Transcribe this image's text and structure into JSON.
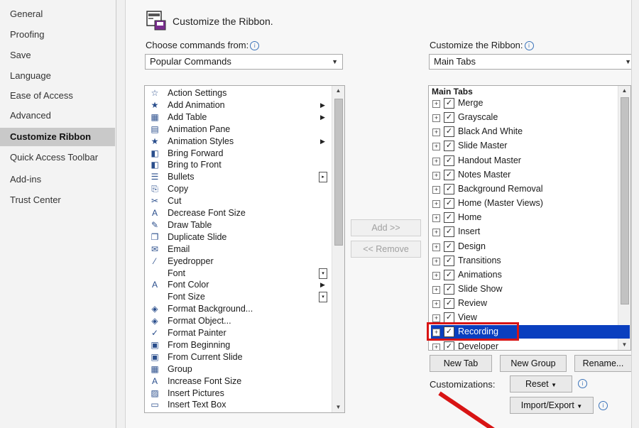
{
  "nav": {
    "items": [
      {
        "label": "General"
      },
      {
        "label": "Proofing"
      },
      {
        "label": "Save"
      },
      {
        "label": "Language"
      },
      {
        "label": "Ease of Access"
      },
      {
        "label": "Advanced"
      },
      {
        "label": "Customize Ribbon"
      },
      {
        "label": "Quick Access Toolbar"
      },
      {
        "label": "Add-ins"
      },
      {
        "label": "Trust Center"
      }
    ],
    "active_index": 6
  },
  "header": {
    "title": "Customize the Ribbon."
  },
  "left": {
    "label": "Choose commands from:",
    "combo_value": "Popular Commands",
    "commands": [
      {
        "label": "Action Settings",
        "icon": "☆"
      },
      {
        "label": "Add Animation",
        "icon": "★",
        "submenu": true
      },
      {
        "label": "Add Table",
        "icon": "▦",
        "submenu": true
      },
      {
        "label": "Animation Pane",
        "icon": "▤"
      },
      {
        "label": "Animation Styles",
        "icon": "★",
        "submenu": true
      },
      {
        "label": "Bring Forward",
        "icon": "◧"
      },
      {
        "label": "Bring to Front",
        "icon": "◧"
      },
      {
        "label": "Bullets",
        "icon": "☰",
        "box": "▸"
      },
      {
        "label": "Copy",
        "icon": "⎘"
      },
      {
        "label": "Cut",
        "icon": "✂"
      },
      {
        "label": "Decrease Font Size",
        "icon": "A"
      },
      {
        "label": "Draw Table",
        "icon": "✎"
      },
      {
        "label": "Duplicate Slide",
        "icon": "❐"
      },
      {
        "label": "Email",
        "icon": "✉"
      },
      {
        "label": "Eyedropper",
        "icon": "⁄"
      },
      {
        "label": "Font",
        "icon": "",
        "box": "▾"
      },
      {
        "label": "Font Color",
        "icon": "A",
        "submenu": true
      },
      {
        "label": "Font Size",
        "icon": "",
        "box": "▾"
      },
      {
        "label": "Format Background...",
        "icon": "◈"
      },
      {
        "label": "Format Object...",
        "icon": "◈"
      },
      {
        "label": "Format Painter",
        "icon": "✓"
      },
      {
        "label": "From Beginning",
        "icon": "▣"
      },
      {
        "label": "From Current Slide",
        "icon": "▣"
      },
      {
        "label": "Group",
        "icon": "▦"
      },
      {
        "label": "Increase Font Size",
        "icon": "A"
      },
      {
        "label": "Insert Pictures",
        "icon": "▨"
      },
      {
        "label": "Insert Text Box",
        "icon": "▭"
      }
    ]
  },
  "middle": {
    "add_label": "Add >>",
    "remove_label": "<< Remove"
  },
  "right": {
    "label": "Customize the Ribbon:",
    "combo_value": "Main Tabs",
    "list_header": "Main Tabs",
    "tabs": [
      {
        "label": "Merge",
        "checked": true
      },
      {
        "label": "Grayscale",
        "checked": true
      },
      {
        "label": "Black And White",
        "checked": true
      },
      {
        "label": "Slide Master",
        "checked": true
      },
      {
        "label": "Handout Master",
        "checked": true
      },
      {
        "label": "Notes Master",
        "checked": true
      },
      {
        "label": "Background Removal",
        "checked": true
      },
      {
        "label": "Home (Master Views)",
        "checked": true
      },
      {
        "label": "Home",
        "checked": true
      },
      {
        "label": "Insert",
        "checked": true
      },
      {
        "label": "Design",
        "checked": true
      },
      {
        "label": "Transitions",
        "checked": true
      },
      {
        "label": "Animations",
        "checked": true
      },
      {
        "label": "Slide Show",
        "checked": true
      },
      {
        "label": "Review",
        "checked": true
      },
      {
        "label": "View",
        "checked": true
      },
      {
        "label": "Recording",
        "checked": true,
        "selected": true
      },
      {
        "label": "Developer",
        "checked": true
      }
    ],
    "new_tab_label": "New Tab",
    "new_group_label": "New Group",
    "rename_label": "Rename...",
    "customizations_label": "Customizations:",
    "reset_label": "Reset",
    "import_export_label": "Import/Export"
  },
  "colors": {
    "selection": "#0a3fbf",
    "highlight": "#d81414"
  }
}
